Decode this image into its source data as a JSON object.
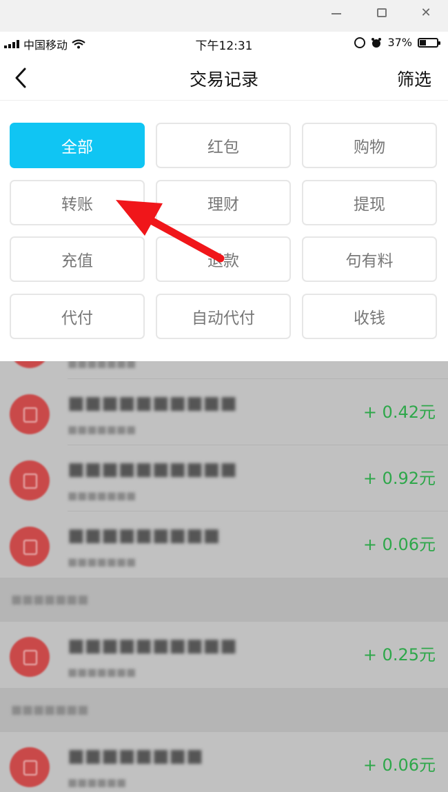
{
  "window": {
    "minimize_icon": "minimize-icon",
    "maximize_icon": "maximize-icon",
    "close_glyph": "✕"
  },
  "status_bar": {
    "carrier": "中国移动",
    "time": "下午12:31",
    "battery": "37%",
    "battery_level": 0.37
  },
  "nav": {
    "title": "交易记录",
    "filter": "筛选"
  },
  "filters": [
    {
      "label": "全部",
      "active": true
    },
    {
      "label": "红包",
      "active": false
    },
    {
      "label": "购物",
      "active": false
    },
    {
      "label": "转账",
      "active": false
    },
    {
      "label": "理财",
      "active": false
    },
    {
      "label": "提现",
      "active": false
    },
    {
      "label": "充值",
      "active": false
    },
    {
      "label": "退款",
      "active": false
    },
    {
      "label": "句有料",
      "active": false
    },
    {
      "label": "代付",
      "active": false
    },
    {
      "label": "自动代付",
      "active": false
    },
    {
      "label": "收钱",
      "active": false
    }
  ],
  "transactions": [
    {
      "amount": "+ 0.42元"
    },
    {
      "amount": "+ 0.92元"
    },
    {
      "amount": "+ 0.06元"
    },
    {
      "amount": "+ 0.25元"
    },
    {
      "amount": "+ 0.06元"
    }
  ],
  "colors": {
    "accent": "#10c5f3",
    "arrow": "#f0161a",
    "amount_green": "#2ea74a"
  }
}
